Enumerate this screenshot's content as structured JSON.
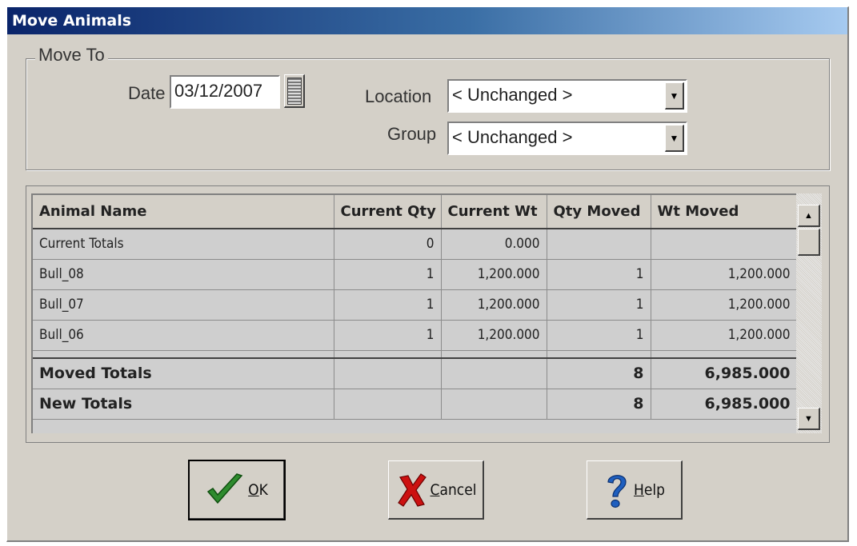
{
  "window": {
    "title": "Move Animals"
  },
  "move_to": {
    "group_label": "Move To",
    "date_label": "Date",
    "date_value": "03/12/2007",
    "location_label": "Location",
    "location_value": "< Unchanged >",
    "group_field_label": "Group",
    "group_value": "< Unchanged >"
  },
  "grid": {
    "columns": [
      "Animal Name",
      "Current Qty",
      "Current Wt",
      "Qty Moved",
      "Wt Moved"
    ],
    "rows": [
      {
        "name": "Current Totals",
        "current_qty": "0",
        "current_wt": "0.000",
        "qty_moved": "",
        "wt_moved": ""
      },
      {
        "name": "Bull_08",
        "current_qty": "1",
        "current_wt": "1,200.000",
        "qty_moved": "1",
        "wt_moved": "1,200.000"
      },
      {
        "name": "Bull_07",
        "current_qty": "1",
        "current_wt": "1,200.000",
        "qty_moved": "1",
        "wt_moved": "1,200.000"
      },
      {
        "name": "Bull_06",
        "current_qty": "1",
        "current_wt": "1,200.000",
        "qty_moved": "1",
        "wt_moved": "1,200.000"
      }
    ],
    "totals": [
      {
        "name": "Moved Totals",
        "current_qty": "",
        "current_wt": "",
        "qty_moved": "8",
        "wt_moved": "6,985.000"
      },
      {
        "name": "New Totals",
        "current_qty": "",
        "current_wt": "",
        "qty_moved": "8",
        "wt_moved": "6,985.000"
      }
    ]
  },
  "buttons": {
    "ok_prefix": "",
    "ok_mnemonic": "O",
    "ok_rest": "K",
    "cancel_mnemonic": "C",
    "cancel_rest": "ancel",
    "help_mnemonic": "H",
    "help_rest": "elp"
  },
  "colors": {
    "titlebar_start": "#0a246a",
    "titlebar_end": "#a6caf0",
    "ok_check": "#2e8b2e",
    "cancel_x": "#cc1111",
    "help_q": "#1f5fbf"
  }
}
